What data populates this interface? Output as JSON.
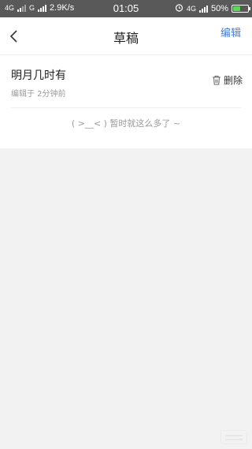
{
  "status_bar": {
    "network1": "4G",
    "network2": "G",
    "speed": "2.9K/s",
    "time": "01:05",
    "network3": "4G",
    "battery": "50%",
    "battery_level": 0.5,
    "battery_color": "#5cd65c"
  },
  "header": {
    "title": "草稿",
    "edit_label": "编辑",
    "back_icon": "chevron-left-icon"
  },
  "drafts": [
    {
      "title": "明月几时有",
      "meta": "编辑于 2分钟前",
      "delete_label": "删除",
      "delete_icon": "trash-icon"
    }
  ],
  "empty_note": "( >__< ) 暂时就这么多了 ~",
  "colors": {
    "accent": "#3d7de6",
    "status_bar_bg": "#595959",
    "page_bg": "#f2f2f2"
  }
}
